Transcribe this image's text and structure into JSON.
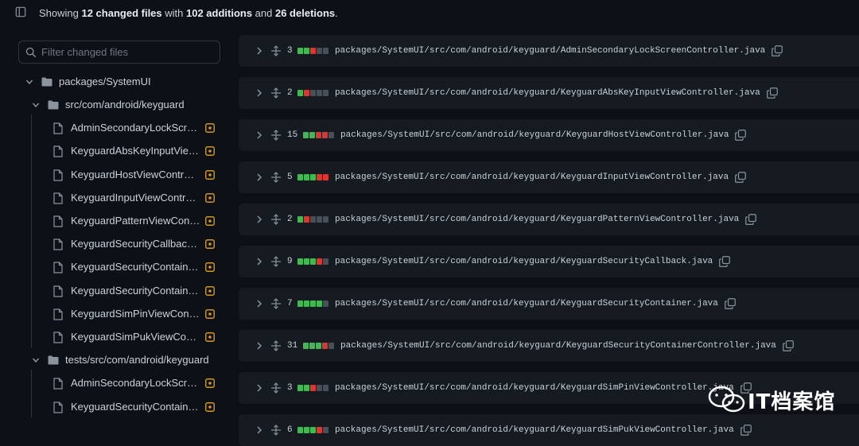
{
  "summary": {
    "prefix": "Showing ",
    "files": "12 changed files",
    "mid1": " with ",
    "additions": "102 additions",
    "mid2": " and ",
    "deletions": "26 deletions",
    "suffix": "."
  },
  "filter": {
    "placeholder": "Filter changed files"
  },
  "tree": {
    "root": "packages/SystemUI",
    "folders": [
      {
        "label": "src/com/android/keyguard",
        "files": [
          "AdminSecondaryLockScr…",
          "KeyguardAbsKeyInputVie…",
          "KeyguardHostViewContr…",
          "KeyguardInputViewContr…",
          "KeyguardPatternViewCon…",
          "KeyguardSecurityCallbac…",
          "KeyguardSecurityContain…",
          "KeyguardSecurityContain…",
          "KeyguardSimPinViewCon…",
          "KeyguardSimPukViewCo…"
        ]
      },
      {
        "label": "tests/src/com/android/keyguard",
        "files": [
          "AdminSecondaryLockScr…",
          "KeyguardSecurityContain…"
        ]
      }
    ]
  },
  "colors": {
    "added": "#3fb950",
    "deleted": "#da3633",
    "neutral": "#484f58",
    "modified_icon": "#d29922"
  },
  "diffs": [
    {
      "count": "3",
      "bars": [
        "added",
        "added",
        "deleted",
        "neutral",
        "neutral"
      ],
      "path": "packages/SystemUI/src/com/android/keyguard/AdminSecondaryLockScreenController.java"
    },
    {
      "count": "2",
      "bars": [
        "added",
        "deleted",
        "neutral",
        "neutral",
        "neutral"
      ],
      "path": "packages/SystemUI/src/com/android/keyguard/KeyguardAbsKeyInputViewController.java"
    },
    {
      "count": "15",
      "bars": [
        "added",
        "added",
        "deleted",
        "deleted",
        "neutral"
      ],
      "path": "packages/SystemUI/src/com/android/keyguard/KeyguardHostViewController.java"
    },
    {
      "count": "5",
      "bars": [
        "added",
        "added",
        "added",
        "deleted",
        "deleted"
      ],
      "path": "packages/SystemUI/src/com/android/keyguard/KeyguardInputViewController.java"
    },
    {
      "count": "2",
      "bars": [
        "added",
        "deleted",
        "neutral",
        "neutral",
        "neutral"
      ],
      "path": "packages/SystemUI/src/com/android/keyguard/KeyguardPatternViewController.java"
    },
    {
      "count": "9",
      "bars": [
        "added",
        "added",
        "added",
        "deleted",
        "neutral"
      ],
      "path": "packages/SystemUI/src/com/android/keyguard/KeyguardSecurityCallback.java"
    },
    {
      "count": "7",
      "bars": [
        "added",
        "added",
        "added",
        "added",
        "neutral"
      ],
      "path": "packages/SystemUI/src/com/android/keyguard/KeyguardSecurityContainer.java"
    },
    {
      "count": "31",
      "bars": [
        "added",
        "added",
        "added",
        "deleted",
        "neutral"
      ],
      "path": "packages/SystemUI/src/com/android/keyguard/KeyguardSecurityContainerController.java"
    },
    {
      "count": "3",
      "bars": [
        "added",
        "added",
        "deleted",
        "neutral",
        "neutral"
      ],
      "path": "packages/SystemUI/src/com/android/keyguard/KeyguardSimPinViewController.java"
    },
    {
      "count": "6",
      "bars": [
        "added",
        "added",
        "added",
        "deleted",
        "neutral"
      ],
      "path": "packages/SystemUI/src/com/android/keyguard/KeyguardSimPukViewController.java"
    }
  ],
  "watermark": {
    "text": "IT档案馆"
  }
}
